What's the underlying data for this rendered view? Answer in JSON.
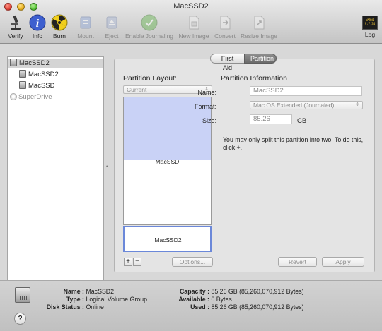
{
  "window": {
    "title": "MacSSD2"
  },
  "toolbar": [
    {
      "label": "Verify",
      "icon": "microscope-icon",
      "enabled": true
    },
    {
      "label": "Info",
      "icon": "info-icon",
      "enabled": true
    },
    {
      "label": "Burn",
      "icon": "radiation-icon",
      "enabled": true
    },
    {
      "label": "Mount",
      "icon": "mount-icon",
      "enabled": false
    },
    {
      "label": "Eject",
      "icon": "eject-icon",
      "enabled": false
    },
    {
      "label": "Enable Journaling",
      "icon": "journaling-icon",
      "enabled": false
    },
    {
      "label": "New Image",
      "icon": "new-image-icon",
      "enabled": false
    },
    {
      "label": "Convert",
      "icon": "convert-icon",
      "enabled": false
    },
    {
      "label": "Resize Image",
      "icon": "resize-image-icon",
      "enabled": false
    },
    {
      "label": "Log",
      "icon": "log-icon",
      "enabled": true
    }
  ],
  "log_screen_text": [
    "WARNI",
    "9:7:34"
  ],
  "sidebar": {
    "items": [
      {
        "label": "MacSSD2",
        "level": 0,
        "selected": true
      },
      {
        "label": "MacSSD2",
        "level": 1,
        "selected": false
      },
      {
        "label": "MacSSD",
        "level": 1,
        "selected": false
      },
      {
        "label": "SuperDrive",
        "level": 0,
        "selected": false,
        "dimmed": true
      }
    ]
  },
  "tabs": [
    {
      "label": "First Aid",
      "selected": false
    },
    {
      "label": "Partition",
      "selected": true
    }
  ],
  "partition": {
    "layout_heading": "Partition Layout:",
    "layout_value": "Current",
    "map": [
      {
        "label": "MacSSD",
        "used_fraction": 0.49
      },
      {
        "label": "MacSSD2",
        "selected": true
      }
    ],
    "add_label": "+",
    "remove_label": "−",
    "options_label": "Options...",
    "info_heading": "Partition Information",
    "name_label": "Name:",
    "name_value": "MacSSD2",
    "format_label": "Format:",
    "format_value": "Mac OS Extended (Journaled)",
    "size_label": "Size:",
    "size_value": "85.26",
    "size_unit": "GB",
    "info_text": "You may only split this partition into two. To do this, click +.",
    "revert_label": "Revert",
    "apply_label": "Apply"
  },
  "disk_info": {
    "name_key": "Name :",
    "name_value": "MacSSD2",
    "type_key": "Type :",
    "type_value": "Logical Volume Group",
    "status_key": "Disk Status :",
    "status_value": "Online",
    "capacity_key": "Capacity :",
    "capacity_value": "85.26 GB (85,260,070,912 Bytes)",
    "available_key": "Available :",
    "available_value": "0 Bytes",
    "used_key": "Used :",
    "used_value": "85.26 GB (85,260,070,912 Bytes)"
  },
  "help_label": "?"
}
